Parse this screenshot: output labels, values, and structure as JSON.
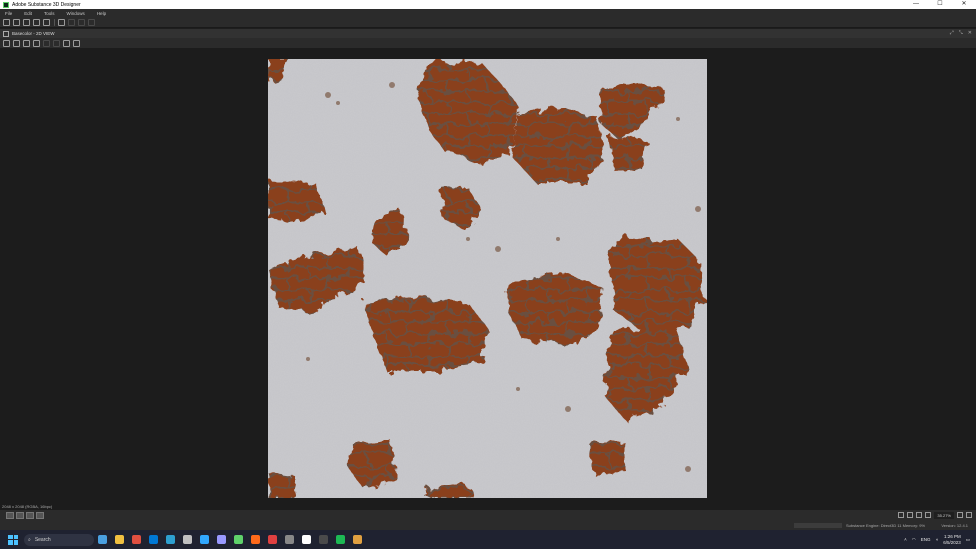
{
  "window": {
    "title": "Adobe Substance 3D Designer",
    "controls": [
      "—",
      "☐",
      "✕"
    ]
  },
  "menu": {
    "items": [
      "File",
      "Edit",
      "Tools",
      "Windows",
      "Help"
    ]
  },
  "panel": {
    "title": "Basecolor - 2D VIEW",
    "controls": [
      "⤢",
      "⤡",
      "✕"
    ]
  },
  "viewport": {
    "info": "2048 x 2048 (RGBA, 16bpc)"
  },
  "bottom": {
    "zoom": "35.27%"
  },
  "status": {
    "engine": "Substance Engine: Direct3D 11   Memory: 9%",
    "version": "Version: 12.4.1"
  },
  "taskbar": {
    "search": "Search",
    "lang": "ENG",
    "time": "1:26 PM",
    "date": "6/5/2023",
    "app_colors": [
      "#4aa0e0",
      "#f0c040",
      "#e05040",
      "#0078d4",
      "#2ea0d0",
      "#c0c0c0",
      "#31a8ff",
      "#9999ff",
      "#5fd16a",
      "#ff6a1a",
      "#e04040",
      "#888888",
      "#ffffff",
      "#4a4a4a",
      "#1db954",
      "#e0a040"
    ]
  },
  "colors": {
    "brick": "#8a3f1e",
    "plaster": "#c9c9cd",
    "accent": "#5fd16a"
  }
}
